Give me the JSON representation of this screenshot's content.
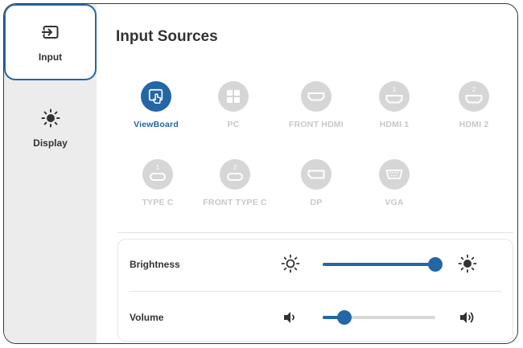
{
  "sidebar": {
    "items": [
      {
        "label": "Input",
        "icon": "input-icon",
        "active": true
      },
      {
        "label": "Display",
        "icon": "brightness-icon",
        "active": false
      }
    ]
  },
  "main": {
    "title": "Input Sources",
    "sources": [
      {
        "label": "ViewBoard",
        "icon": "viewboard-icon",
        "active": true
      },
      {
        "label": "PC",
        "icon": "pc-icon",
        "active": false
      },
      {
        "label": "FRONT HDMI",
        "icon": "hdmi-icon",
        "active": false
      },
      {
        "label": "HDMI 1",
        "icon": "hdmi-icon",
        "badge": "1",
        "active": false
      },
      {
        "label": "HDMI 2",
        "icon": "hdmi-icon",
        "badge": "2",
        "active": false
      },
      {
        "label": "TYPE C",
        "icon": "usb-c-icon",
        "badge": "1",
        "active": false
      },
      {
        "label": "FRONT TYPE C",
        "icon": "usb-c-icon",
        "badge": "2",
        "active": false
      },
      {
        "label": "DP",
        "icon": "displayport-icon",
        "active": false
      },
      {
        "label": "VGA",
        "icon": "vga-icon",
        "active": false
      }
    ]
  },
  "controls": {
    "brightness": {
      "label": "Brightness",
      "value_fraction": 1.0
    },
    "volume": {
      "label": "Volume",
      "value_fraction": 0.19
    }
  },
  "colors": {
    "accent": "#2566a6",
    "inactive": "#d6d6d6",
    "sidebar": "#ececec"
  }
}
